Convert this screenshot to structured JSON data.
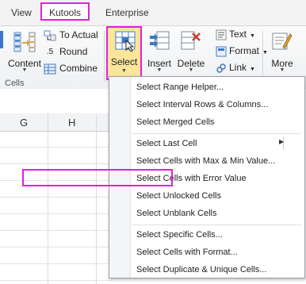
{
  "tabs": [
    "View",
    "Kutools",
    "Enterprise"
  ],
  "ribbon": {
    "content_label": "Content",
    "to_actual_label": "To Actual",
    "round_label": "Round",
    "combine_label": "Combine",
    "select_label": "Select",
    "insert_label": "Insert",
    "delete_label": "Delete",
    "text_label": "Text",
    "format_label": "Format",
    "link_label": "Link",
    "more_label": "More",
    "group_label": "Cells"
  },
  "columns": [
    "G",
    "H"
  ],
  "menu": {
    "items": [
      "Select Range Helper...",
      "Select Interval Rows & Columns...",
      "Select Merged Cells",
      "Select Last Cell",
      "Select Cells with Max & Min Value...",
      "Select Cells with Error Value",
      "Select Unlocked Cells",
      "Select Unblank Cells",
      "Select Specific Cells...",
      "Select Cells with Format...",
      "Select Duplicate & Unique Cells..."
    ],
    "highlighted": "Select Cells with Error Value"
  },
  "colors": {
    "highlight_border": "#e020d8",
    "active_button": "#fbe59a"
  }
}
